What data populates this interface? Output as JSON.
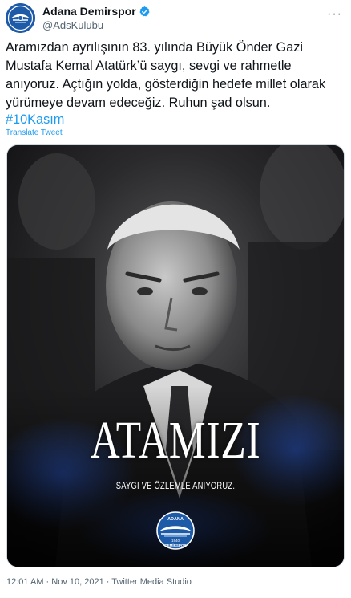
{
  "author": {
    "name": "Adana Demirspor",
    "handle": "@AdsKulubu",
    "verified": true,
    "avatar_icon": "club-logo-icon"
  },
  "tweet": {
    "text": "Aramızdan ayrılışının 83. yılında Büyük Önder Gazi Mustafa Kemal Atatürk’ü saygı, sevgi ve rahmetle anıyoruz. Açtığın yolda, gösterdiğin hedefe millet olarak yürümeye devam edeceğiz. Ruhun şad olsun.",
    "hashtag": "#10Kasım",
    "translate_label": "Translate Tweet"
  },
  "media": {
    "title": "ATAMIZI",
    "subtitle": "SAYGI VE ÖZLEMLE ANIYORUZ.",
    "badge_top": "ADANA",
    "badge_year": "1940",
    "badge_bottom": "DEMİRSPOR"
  },
  "meta": {
    "timestamp": "12:01 AM · Nov 10, 2021 · Twitter Media Studio"
  },
  "colors": {
    "accent": "#1d9bf0",
    "text": "#0f1419",
    "secondary": "#536471",
    "club_blue": "#1d5aa8"
  }
}
